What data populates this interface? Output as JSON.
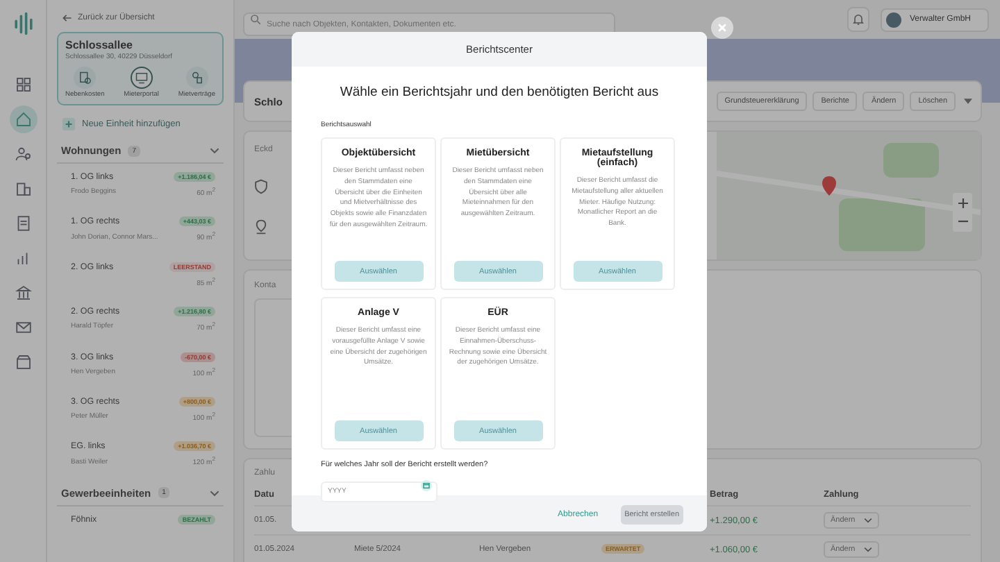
{
  "rail": {
    "items": [
      {
        "kind": "dashboard",
        "selected": false
      },
      {
        "kind": "home",
        "selected": true
      },
      {
        "kind": "people",
        "selected": false
      },
      {
        "kind": "buildings",
        "selected": false
      },
      {
        "kind": "document",
        "selected": false
      },
      {
        "kind": "chart",
        "selected": false
      },
      {
        "kind": "bank",
        "selected": false
      },
      {
        "kind": "mail",
        "selected": false
      },
      {
        "kind": "box",
        "selected": false
      }
    ]
  },
  "sidebar": {
    "back": "Zurück zur Übersicht",
    "property": {
      "name": "Schlossallee",
      "address": "Schlossallee 30, 40229 Düsseldorf",
      "tools": [
        {
          "label": "Nebenkosten",
          "kind": "costs",
          "selected": false
        },
        {
          "label": "Mieterportal",
          "kind": "portal",
          "selected": true
        },
        {
          "label": "Mietverträge",
          "kind": "contracts",
          "selected": false
        }
      ]
    },
    "add_unit": "Neue Einheit hinzufügen",
    "groups": [
      {
        "title": "Wohnungen",
        "count": "7",
        "expanded": true,
        "units": [
          {
            "name": "1. OG links",
            "tenant": "Frodo Beggins",
            "badge": "+1.186,04 €",
            "kind": "paid",
            "area": "60 m$^{2}$"
          },
          {
            "name": "1. OG rechts",
            "tenant": "John Dorian, Connor Mars...",
            "badge": "+443,03 €",
            "kind": "paid",
            "area": "90 m$^{2}$"
          },
          {
            "name": "2. OG links",
            "badge": "LEERSTAND",
            "kind": "vacant",
            "area": "85 m$^{2}$"
          },
          {
            "name": "2. OG rechts",
            "tenant": "Harald Töpfer",
            "badge": "+1.216,80 €",
            "kind": "paid",
            "area": "70 m$^{2}$"
          },
          {
            "name": "3. OG links",
            "tenant": "Hen Vergeben",
            "badge": "-670,00 €",
            "kind": "overdue",
            "area": "100 m$^{2}$"
          },
          {
            "name": "3. OG rechts",
            "tenant": "Peter Müller",
            "badge": "+800,00 €",
            "kind": "partial",
            "area": "100 m$^{2}$"
          },
          {
            "name": "EG. links",
            "tenant": "Basti Weiler",
            "badge": "+1.036,70 €",
            "kind": "partial",
            "area": "120 m$^{2}$"
          }
        ]
      },
      {
        "title": "Gewerbeeinheiten",
        "count": "1",
        "expanded": true,
        "units": [
          {
            "name": "Föhnix",
            "badge": "BEZAHLT",
            "kind": "paid"
          }
        ]
      }
    ]
  },
  "topbar": {
    "search": {
      "placeholder": "Suche nach Objekten, Kontakten, Dokumenten etc."
    },
    "user": "Verwalter GmbH"
  },
  "page": {
    "title": "Schlo",
    "actions": [
      "Grundsteuererklärung",
      "Berichte",
      "Ändern",
      "Löschen"
    ],
    "info_title": "Eckd",
    "contacts_title": "Konta",
    "payments": {
      "title": "Zahlu",
      "columns": [
        "Datu",
        "",
        "",
        "",
        "Betrag",
        "Zahlung"
      ],
      "rows": [
        {
          "date": "01.05.",
          "amount": "+1.290,00 €",
          "action": "Ändern"
        },
        {
          "date": "01.05.2024",
          "text": "Miete 5/2024",
          "name": "Hen Vergeben",
          "status": {
            "label": "ERWARTET",
            "kind": "expected"
          },
          "amount": "+1.060,00 €",
          "action": "Ändern"
        }
      ]
    }
  },
  "modal": {
    "title": "Berichtscenter",
    "heading": "Wähle ein Berichtsjahr und den benötigten Bericht aus",
    "section": "Berichtsauswahl",
    "reports": [
      {
        "title": "Objektübersicht",
        "description": "Dieser Bericht umfasst neben den Stammdaten eine Übersicht über die Einheiten und Mietverhältnisse des Objekts sowie alle Finanzdaten für den ausgewählten Zeitraum.",
        "button": "Auswählen",
        "disabled": true
      },
      {
        "title": "Mietübersicht",
        "description": "Dieser Bericht umfasst neben den Stammdaten eine Übersicht über alle Mieteinnahmen für den ausgewählten Zeitraum.",
        "button": "Auswählen",
        "disabled": true
      },
      {
        "title": "Mietaufstellung (einfach)",
        "description": "Dieser Bericht umfasst die Mietaufstellung aller aktuellen Mieter. Häufige Nutzung: Monatlicher Report an die Bank.",
        "button": "Auswählen",
        "disabled": true
      },
      {
        "title": "Anlage V",
        "description": "Dieser Bericht umfasst eine vorausgefüllte Anlage V sowie eine Übersicht der zugehörigen Umsätze.",
        "button": "Auswählen",
        "disabled": true
      },
      {
        "title": "EÜR",
        "description": "Dieser Bericht umfasst eine Einnahmen-Überschuss-Rechnung sowie eine Übersicht der zugehörigen Umsätze.",
        "button": "Auswählen",
        "disabled": true
      }
    ],
    "year_question": "Für welches Jahr soll der Bericht erstellt werden?",
    "year_field": {
      "placeholder": "YYYY"
    },
    "cancel": "Abbrechen",
    "create": {
      "label": "Bericht erstellen",
      "disabled": true
    }
  }
}
